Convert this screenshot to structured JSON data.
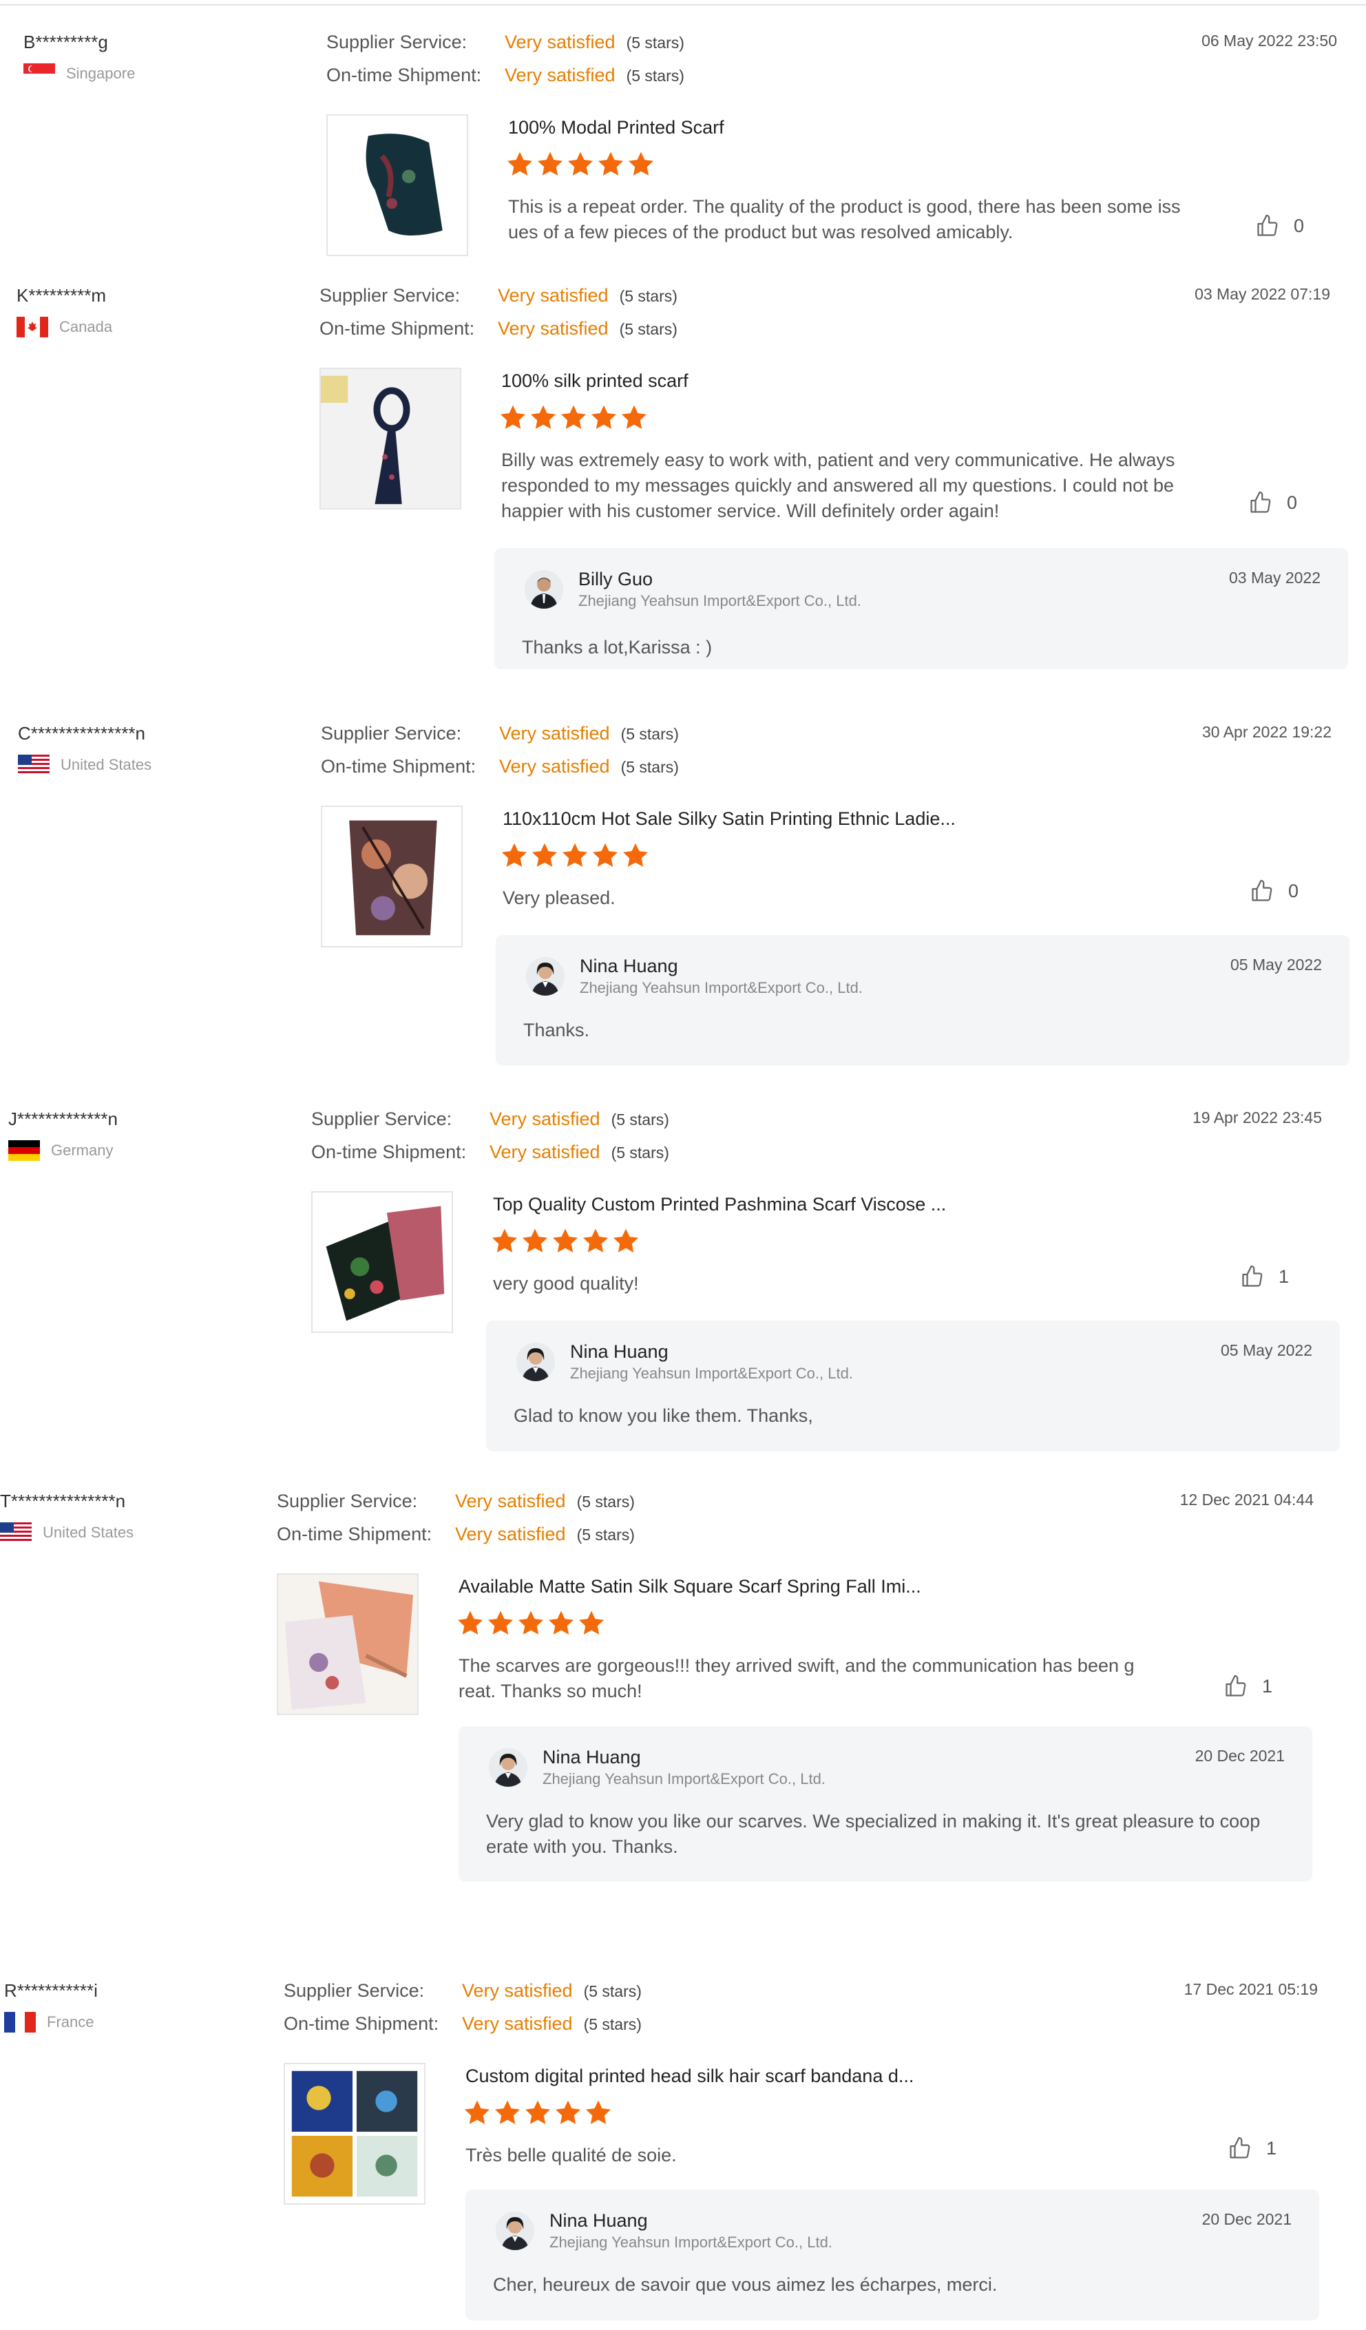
{
  "labels": {
    "supplier_service": "Supplier Service:",
    "ontime_shipment": "On-time Shipment:"
  },
  "colors": {
    "accent": "#e67e00",
    "star": "#f46a0a",
    "reply_bg": "#f4f5f7"
  },
  "reviews": [
    {
      "buyer": "B*********g",
      "country": "Singapore",
      "flag_icon": "singapore-flag-icon",
      "supplier_service": "Very satisfied",
      "supplier_service_stars": "(5 stars)",
      "ontime_shipment": "Very satisfied",
      "ontime_shipment_stars": "(5 stars)",
      "date": "06 May 2022 23:50",
      "product_title": "100% Modal Printed Scarf",
      "rating": 5,
      "comment": "This is a repeat order. The quality of the product is good, there has been some iss ues of a few pieces of the product but was resolved amicably.",
      "likes": "0"
    },
    {
      "buyer": "K*********m",
      "country": "Canada",
      "flag_icon": "canada-flag-icon",
      "supplier_service": "Very satisfied",
      "supplier_service_stars": "(5 stars)",
      "ontime_shipment": "Very satisfied",
      "ontime_shipment_stars": "(5 stars)",
      "date": "03 May 2022 07:19",
      "product_title": "100% silk printed scarf",
      "rating": 5,
      "comment": "Billy was extremely easy to work with, patient and very communicative. He always responded to my messages quickly and answered all my questions. I could not be happier with his customer service. Will definitely order again!",
      "likes": "0",
      "reply": {
        "name": "Billy Guo",
        "company": "Zhejiang Yeahsun Import&Export Co., Ltd.",
        "date": "03 May 2022",
        "text": "Thanks a lot,Karissa : )"
      }
    },
    {
      "buyer": "C***************n",
      "country": "United States",
      "flag_icon": "usa-flag-icon",
      "supplier_service": "Very satisfied",
      "supplier_service_stars": "(5 stars)",
      "ontime_shipment": "Very satisfied",
      "ontime_shipment_stars": "(5 stars)",
      "date": "30 Apr 2022 19:22",
      "product_title": "110x110cm Hot Sale Silky Satin Printing Ethnic Ladie...",
      "rating": 5,
      "comment": "Very pleased.",
      "likes": "0",
      "reply": {
        "name": "Nina Huang",
        "company": "Zhejiang Yeahsun Import&Export Co., Ltd.",
        "date": "05 May 2022",
        "text": "Thanks."
      }
    },
    {
      "buyer": "J*************n",
      "country": "Germany",
      "flag_icon": "germany-flag-icon",
      "supplier_service": "Very satisfied",
      "supplier_service_stars": "(5 stars)",
      "ontime_shipment": "Very satisfied",
      "ontime_shipment_stars": "(5 stars)",
      "date": "19 Apr 2022 23:45",
      "product_title": "Top Quality Custom Printed Pashmina Scarf Viscose ...",
      "rating": 5,
      "comment": "very good quality!",
      "likes": "1",
      "reply": {
        "name": "Nina Huang",
        "company": "Zhejiang Yeahsun Import&Export Co., Ltd.",
        "date": "05 May 2022",
        "text": "Glad to know you like them. Thanks,"
      }
    },
    {
      "buyer": "T***************n",
      "country": "United States",
      "flag_icon": "usa-flag-icon",
      "supplier_service": "Very satisfied",
      "supplier_service_stars": "(5 stars)",
      "ontime_shipment": "Very satisfied",
      "ontime_shipment_stars": "(5 stars)",
      "date": "12 Dec 2021 04:44",
      "product_title": "Available Matte Satin Silk Square Scarf Spring Fall Imi...",
      "rating": 5,
      "comment": "The scarves are gorgeous!!! they arrived swift, and the communication has been g reat. Thanks so much!",
      "likes": "1",
      "reply": {
        "name": "Nina Huang",
        "company": "Zhejiang Yeahsun Import&Export Co., Ltd.",
        "date": "20 Dec 2021",
        "text": "Very glad to know you like our scarves. We specialized in making it. It's great pleasure to coop erate with you. Thanks."
      }
    },
    {
      "buyer": "R***********i",
      "country": "France",
      "flag_icon": "france-flag-icon",
      "supplier_service": "Very satisfied",
      "supplier_service_stars": "(5 stars)",
      "ontime_shipment": "Very satisfied",
      "ontime_shipment_stars": "(5 stars)",
      "date": "17 Dec 2021 05:19",
      "product_title": "Custom digital printed head silk hair scarf bandana d...",
      "rating": 5,
      "comment": "Très belle qualité de soie.",
      "likes": "1",
      "reply": {
        "name": "Nina Huang",
        "company": "Zhejiang Yeahsun Import&Export Co., Ltd.",
        "date": "20 Dec 2021",
        "text": "Cher, heureux de savoir que vous aimez les écharpes, merci."
      }
    }
  ]
}
